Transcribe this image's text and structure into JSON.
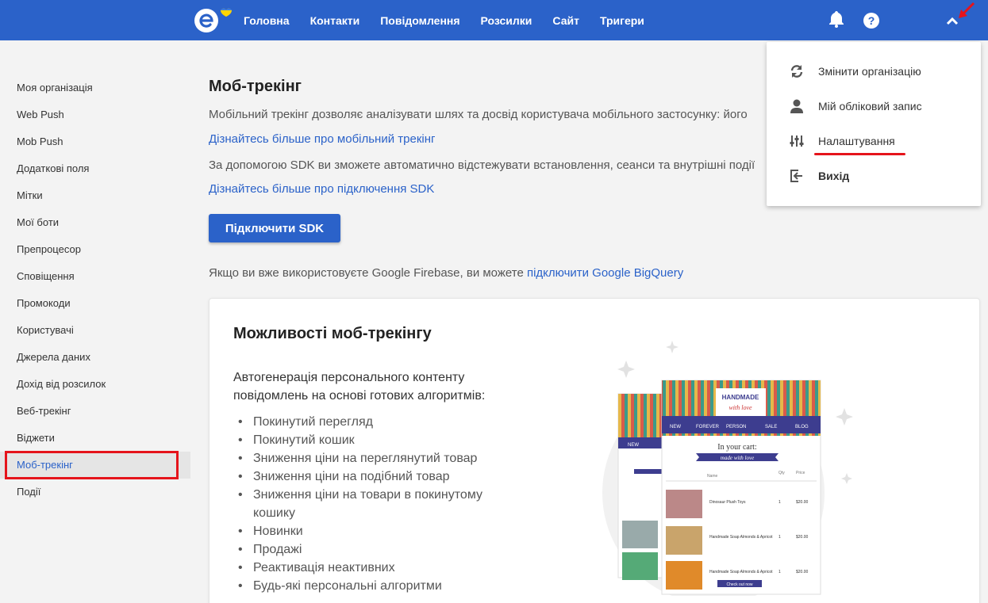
{
  "topbar": {
    "nav": [
      "Головна",
      "Контакти",
      "Повідомлення",
      "Розсилки",
      "Сайт",
      "Тригери"
    ],
    "bell_icon": "bell-icon",
    "help_icon": "help-icon",
    "chevron_icon": "chevron-up-icon",
    "accent": "#2b62c9"
  },
  "sidebar": {
    "items": [
      "Моя організація",
      "Web Push",
      "Mob Push",
      "Додаткові поля",
      "Мітки",
      "Мої боти",
      "Препроцесор",
      "Сповіщення",
      "Промокоди",
      "Користувачі",
      "Джерела даних",
      "Дохід від розсилок",
      "Веб-трекінг",
      "Віджети",
      "Моб-трекінг",
      "Події"
    ],
    "active": "Моб-трекінг"
  },
  "main": {
    "title": "Моб-трекінг",
    "desc1": "Мобільний трекінг дозволяє аналізувати шлях та досвід користувача мобільного застосунку: його",
    "link1": "Дізнайтесь більше про мобільний трекінг",
    "desc2": "За допомогою SDK ви зможете автоматично відстежувати встановлення, сеанси та внутрішні події",
    "link2": "Дізнайтесь більше про підключення SDK",
    "button": "Підключити SDK",
    "firebase_text": "Якщо ви вже використовуєте Google Firebase, ви можете ",
    "firebase_link": "підключити Google BigQuery"
  },
  "card": {
    "title": "Можливості моб-трекінгу",
    "desc": "Автогенерація персонального контенту повідомлень на основі готових алгоритмів:",
    "features": [
      "Покинутий перегляд",
      "Покинутий кошик",
      "Зниження ціни на переглянутий товар",
      "Зниження ціни на подібний товар",
      "Зниження ціни на товари в покинутому кошику",
      "Новинки",
      "Продажі",
      "Реактивація неактивних",
      "Будь-які персональні алгоритми"
    ],
    "illustration": {
      "brand": "HANDMADE",
      "brand_sub": "with love",
      "nav": [
        "NEW",
        "FOREVER",
        "PERSON",
        "SALE",
        "BLOG"
      ],
      "cart_title": "In your cart:",
      "cart_sub": "made with love",
      "col_name": "Name",
      "col_qty": "Qty",
      "col_price": "Price",
      "rows": [
        {
          "name": "Dinosaur Plush Toys",
          "qty": "1",
          "price": "$20.00"
        },
        {
          "name": "Handmade Soap Almonds & Apricot",
          "qty": "1",
          "price": "$20.00"
        },
        {
          "name": "Handmade Soap Almonds & Apricot",
          "qty": "1",
          "price": "$20.00"
        }
      ],
      "checkout": "Check out now"
    }
  },
  "dropdown": {
    "items": [
      {
        "label": "Змінити організацію",
        "icon": "sync-icon"
      },
      {
        "label": "Мій обліковий запис",
        "icon": "user-icon"
      },
      {
        "label": "Налаштування",
        "icon": "sliders-icon"
      },
      {
        "label": "Вихід",
        "icon": "logout-icon"
      }
    ]
  },
  "highlight_color": "#e5141b"
}
